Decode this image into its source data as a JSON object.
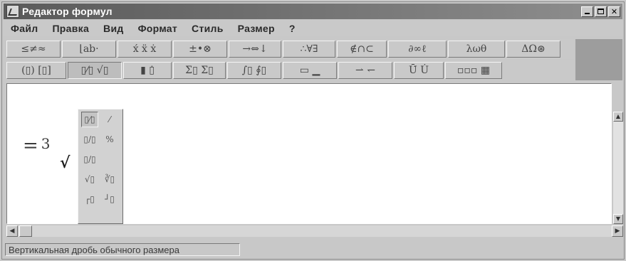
{
  "window": {
    "title": "Редактор формул"
  },
  "menu": {
    "items": [
      {
        "label": "Файл"
      },
      {
        "label": "Правка"
      },
      {
        "label": "Вид"
      },
      {
        "label": "Формат"
      },
      {
        "label": "Стиль"
      },
      {
        "label": "Размер"
      },
      {
        "label": "?"
      }
    ]
  },
  "toolbar1": {
    "groups": [
      {
        "icon": "relations-palette-icon",
        "glyph": "≤≠≈"
      },
      {
        "icon": "spacing-palette-icon",
        "glyph": "⌊ab·"
      },
      {
        "icon": "embellishments-palette-icon",
        "glyph": "x́ ẍ ẋ"
      },
      {
        "icon": "operators-palette-icon",
        "glyph": "±•⊗"
      },
      {
        "icon": "arrows-palette-icon",
        "glyph": "→⇔↓"
      },
      {
        "icon": "logic-palette-icon",
        "glyph": "∴∀∃"
      },
      {
        "icon": "sets-palette-icon",
        "glyph": "∉∩⊂"
      },
      {
        "icon": "misc-symbols-palette-icon",
        "glyph": "∂∞ℓ"
      },
      {
        "icon": "greek-lowercase-palette-icon",
        "glyph": "λωθ"
      },
      {
        "icon": "greek-uppercase-palette-icon",
        "glyph": "ΔΩ⊛"
      }
    ]
  },
  "toolbar2": {
    "groups": [
      {
        "icon": "fences-palette-icon",
        "glyph": "(▯) [▯]"
      },
      {
        "icon": "fractions-radicals-palette-icon",
        "glyph": "▯⁄▯ √▯",
        "pressed": true
      },
      {
        "icon": "subscripts-palette-icon",
        "glyph": "▮ ▯̇"
      },
      {
        "icon": "summations-palette-icon",
        "glyph": "Σ▯ Σ▯"
      },
      {
        "icon": "integrals-palette-icon",
        "glyph": "∫▯ ∮▯"
      },
      {
        "icon": "underbars-overbars-palette-icon",
        "glyph": "▭ ▁"
      },
      {
        "icon": "labeled-arrows-palette-icon",
        "glyph": "⇀ ↽"
      },
      {
        "icon": "products-palette-icon",
        "glyph": "Ū̇ U̇"
      },
      {
        "icon": "matrices-palette-icon",
        "glyph": "▫▫▫ ▦"
      }
    ]
  },
  "palette": {
    "items": [
      {
        "icon": "full-fraction-icon",
        "glyph": "▯⁄▯",
        "selected": true
      },
      {
        "icon": "small-fraction-icon",
        "glyph": "⁄"
      },
      {
        "icon": "slash-fraction-icon",
        "glyph": "▯/▯"
      },
      {
        "icon": "small-slash-fraction-icon",
        "glyph": "%"
      },
      {
        "icon": "inline-slash-fraction-icon",
        "glyph": "▯/▯"
      },
      {
        "icon": "square-root-icon",
        "glyph": "√▯"
      },
      {
        "icon": "nth-root-icon",
        "glyph": "∛▯"
      },
      {
        "icon": "long-division-icon",
        "glyph": "┌▯"
      },
      {
        "icon": "long-division-alt-icon",
        "glyph": "┘▯"
      }
    ]
  },
  "editor": {
    "formula_eq": "=",
    "formula_num": "3"
  },
  "statusbar": {
    "text": "Вертикальная дробь обычного размера"
  }
}
